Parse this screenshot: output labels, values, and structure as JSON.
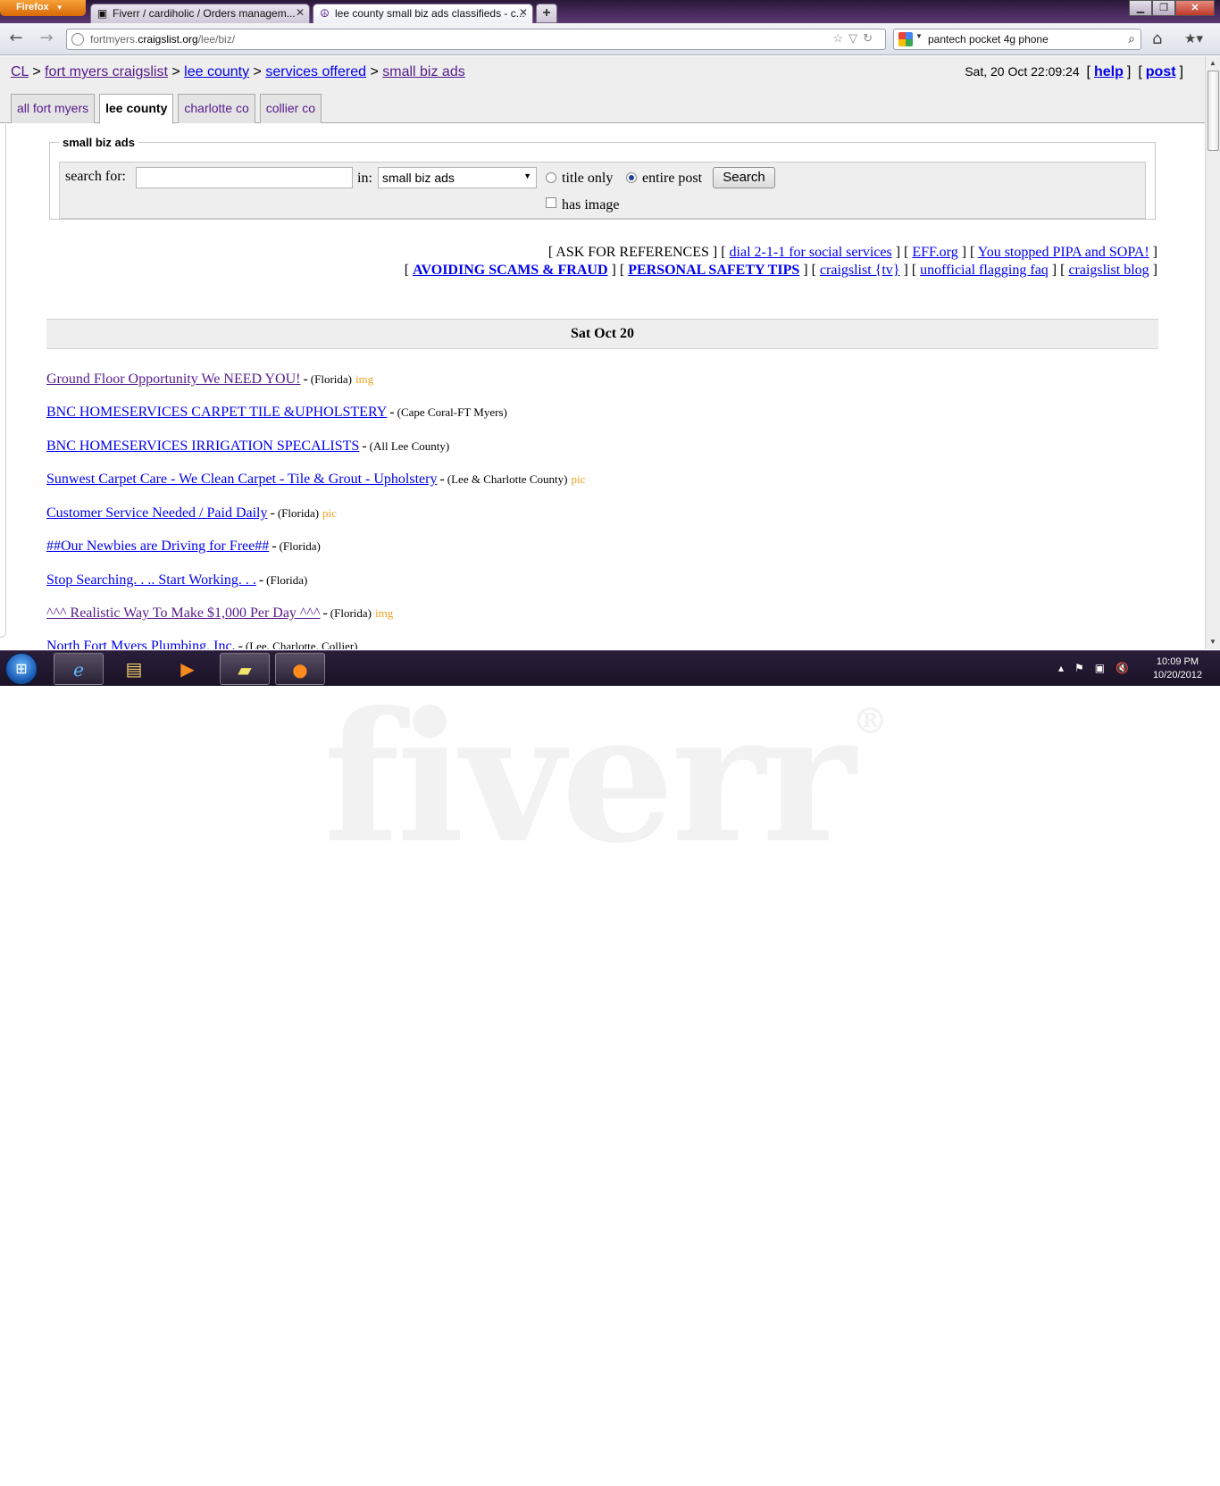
{
  "browser": {
    "menu_label": "Firefox",
    "tabs": [
      {
        "title": "Fiverr / cardiholic / Orders managem...",
        "favicon": "fiverr-icon"
      },
      {
        "title": "lee county small biz ads classifieds - c...",
        "favicon": "peace-icon"
      }
    ],
    "new_tab": "+",
    "url_prefix": "fortmyers.",
    "url_domain": "craigslist.org",
    "url_path": "/lee/biz/",
    "search_query": "pantech pocket 4g phone"
  },
  "page": {
    "breadcrumbs": [
      "CL",
      "fort myers craigslist",
      "lee county",
      "services offered",
      "small biz ads"
    ],
    "timestamp": "Sat, 20 Oct 22:09:24",
    "help_label": "help",
    "post_label": "post",
    "area_tabs": [
      "all fort myers",
      "lee county",
      "charlotte co",
      "collier co"
    ],
    "search": {
      "legend": "small biz ads",
      "search_for_label": "search for:",
      "in_label": "in:",
      "category": "small biz ads",
      "title_only_label": "title only",
      "entire_post_label": "entire post",
      "selected_scope": "entire post",
      "has_image_label": "has image",
      "button_label": "Search"
    },
    "info_links_row1": {
      "ask": "ASK FOR REFERENCES",
      "dial": "dial 2-1-1 for social services",
      "eff": "EFF.org",
      "pipa": "You stopped PIPA and SOPA!"
    },
    "info_links_row2": {
      "scams": "AVOIDING SCAMS & FRAUD",
      "safety": "PERSONAL SAFETY TIPS",
      "tv": "craigslist {tv}",
      "flagging": "unofficial flagging faq",
      "blog": "craigslist blog"
    },
    "date_header": "Sat Oct 20",
    "listings": [
      {
        "title": "Ground Floor Opportunity We NEED YOU!",
        "location": "(Florida)",
        "tag": "img"
      },
      {
        "title": "BNC HOMESERVICES CARPET TILE &UPHOLSTERY",
        "location": "(Cape Coral-FT Myers)",
        "tag": ""
      },
      {
        "title": "BNC HOMESERVICES IRRIGATION SPECALISTS",
        "location": "(All Lee County)",
        "tag": ""
      },
      {
        "title": "Sunwest Carpet Care - We Clean Carpet - Tile & Grout - Upholstery",
        "location": "(Lee & Charlotte County)",
        "tag": "pic"
      },
      {
        "title": "Customer Service Needed / Paid Daily",
        "location": "(Florida)",
        "tag": "pic"
      },
      {
        "title": "##Our Newbies are Driving for Free##",
        "location": "(Florida)",
        "tag": ""
      },
      {
        "title": "Stop Searching. . .. Start Working. . .",
        "location": "(Florida)",
        "tag": ""
      },
      {
        "title": "^^^ Realistic Way To Make $1,000 Per Day ^^^",
        "location": "(Florida)",
        "tag": "img"
      },
      {
        "title": "North Fort Myers Plumbing, Inc.",
        "location": "(Lee, Charlotte, Collier)",
        "tag": ""
      }
    ]
  },
  "taskbar": {
    "time": "10:09 PM",
    "date": "10/20/2012"
  },
  "watermark": "fiverr",
  "watermark_mark": "®"
}
